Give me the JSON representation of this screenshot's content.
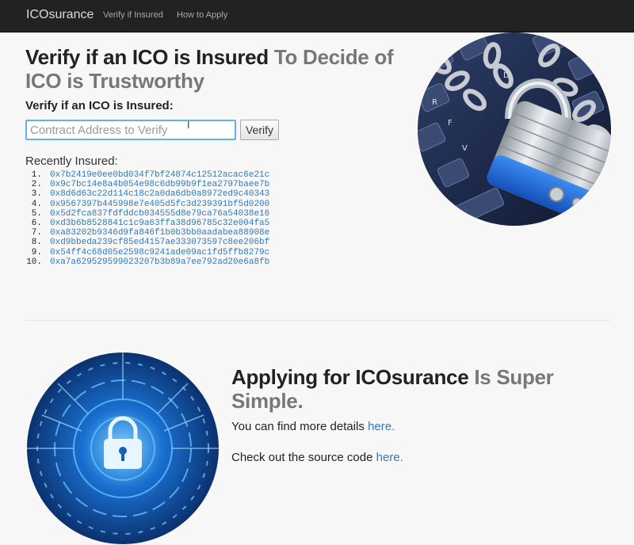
{
  "navbar": {
    "brand": "ICOsurance",
    "links": [
      "Verify if Insured",
      "How to Apply"
    ]
  },
  "hero": {
    "heading_strong": "Verify if an ICO is Insured",
    "heading_muted": "To Decide of ICO is Trustworthy"
  },
  "verify_form": {
    "label": "Verify if an ICO is Insured:",
    "placeholder": "Contract Address to Verify",
    "value": "",
    "button": "Verify"
  },
  "recent": {
    "label": "Recently Insured:",
    "items": [
      "0x7b2419e0ee0bd034f7bf24874c12512acac6e21c",
      "0x9c7bc14e8a4b054e98c6db99b9f1ea2797baee7b",
      "0x8d6d63c22d114c18c2a0da6db0a8972ed9c40343",
      "0x9567397b445998e7e405d5fc3d239391bf5d0200",
      "0x5d2fca837fdfddcb034555d8e79ca76a54038e16",
      "0xd3b6b8528841c1c9a63ffa38d96785c32e004fa5",
      "0xa83202b9346d9fa846f1b0b3bb0aadabea88908e",
      "0xd9bbeda239cf85ed4157ae333073597c8ee206bf",
      "0x54ff4c68d05e2598c9241ade09ac1fd5ffb8279c",
      "0xa7a629529599023207b3b89a7ee792ad20e6a8fb"
    ]
  },
  "apply": {
    "heading_strong": "Applying for ICOsurance",
    "heading_muted": "Is Super Simple.",
    "details_text": "You can find more details",
    "details_link": "here.",
    "source_text": "Check out the source code",
    "source_link": "here."
  },
  "images": {
    "padlock_chain": "padlock-chained-keyboard-image",
    "digital_lock": "digital-lock-circuit-image"
  },
  "colors": {
    "link": "#337ab7",
    "navbar": "#222222",
    "input_focus": "#66afe9"
  }
}
